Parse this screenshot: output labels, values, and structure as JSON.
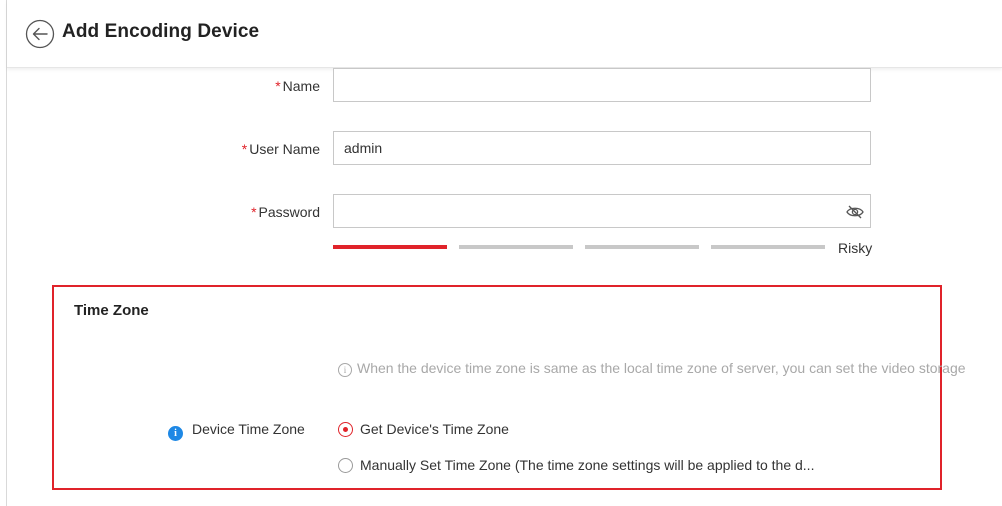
{
  "header": {
    "title": "Add Encoding Device",
    "back_icon": "back-arrow-circle-icon"
  },
  "form": {
    "name": {
      "label": "Name",
      "value": "",
      "required": true
    },
    "user_name": {
      "label": "User Name",
      "value": "admin",
      "required": true
    },
    "password": {
      "label": "Password",
      "value": "",
      "required": true,
      "toggle_icon": "eye-slash-icon"
    },
    "strength": {
      "text": "Risky",
      "level": 1,
      "segments": 5,
      "color_active": "#e0232a",
      "color_inactive": "#c8c8c8"
    }
  },
  "time_zone": {
    "title": "Time Zone",
    "info_text": "When the device time zone is same as the local time zone of server, you can set the video storage",
    "device_tz_label": "Device Time Zone",
    "options": [
      {
        "label": "Get Device's Time Zone",
        "checked": true
      },
      {
        "label": "Manually Set Time Zone (The time zone settings will be applied to the d...",
        "checked": false
      }
    ]
  },
  "colors": {
    "accent": "#e0232a",
    "info_blue": "#1e88e5"
  }
}
